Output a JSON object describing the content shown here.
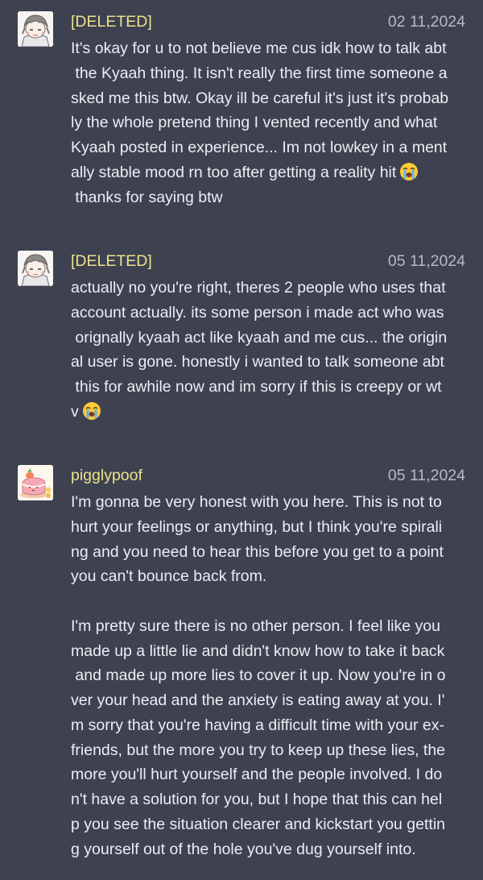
{
  "messages": [
    {
      "username": "[DELETED]",
      "timestamp": "02 11,2024",
      "avatar_icon": "anime-character-avatar-icon",
      "lines": [
        "It's okay for u to not believe me cus idk how to talk abt",
        " the Kyaah thing. It isn't really the first time someone a",
        "sked me this btw. Okay ill be careful it's just it's probab",
        "ly the whole pretend thing I vented recently and what",
        "Kyaah posted in experience... Im not lowkey in a ment",
        "ally stable mood rn too after getting a reality hit",
        " thanks for saying btw"
      ],
      "emoji_line_index": 5,
      "emoji_icon": "loudly-crying-face-icon"
    },
    {
      "username": "[DELETED]",
      "timestamp": "05 11,2024",
      "avatar_icon": "anime-character-avatar-icon",
      "lines": [
        "actually no you're right, theres 2 people who uses that",
        "account actually. its some person i made act who was",
        " orignally kyaah act like kyaah and me cus... the origin",
        "al user is gone. honestly i wanted to talk someone abt",
        " this for awhile now and im sorry if this is creepy or wt",
        "v"
      ],
      "emoji_line_index": 5,
      "emoji_icon": "loudly-crying-face-icon"
    },
    {
      "username": "pigglypoof",
      "timestamp": "05 11,2024",
      "avatar_icon": "pink-cake-avatar-icon",
      "lines": [
        "I'm gonna be very honest with you here. This is not to",
        "hurt your feelings or anything, but I think you're spirali",
        "ng and you need to hear this before you get to a point",
        "you can't bounce back from.",
        "",
        "I'm pretty sure there is no other person. I feel like you",
        "made up a little lie and didn't know how to take it back",
        " and made up more lies to cover it up. Now you're in o",
        "ver your head and the anxiety is eating away at you. I'",
        "m sorry that you're having a difficult time with your ex-",
        "friends, but the more you try to keep up these lies, the",
        "more you'll hurt yourself and the people involved. I do",
        "n't have a solution for you, but I hope that this can hel",
        "p you see the situation clearer and kickstart you gettin",
        "g yourself out of the hole you've dug yourself into."
      ]
    }
  ],
  "colors": {
    "background": "#3d4150",
    "username": "#ece38b",
    "timestamp": "#b7bac4",
    "text": "#eceef3"
  }
}
